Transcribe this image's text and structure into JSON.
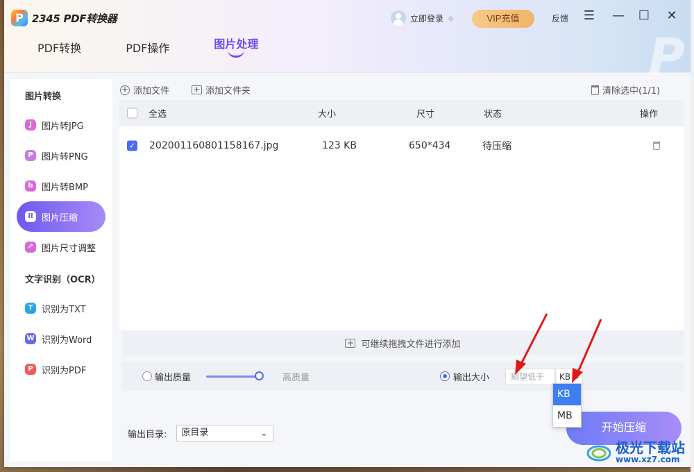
{
  "app": {
    "title": "2345 PDF转换器"
  },
  "header": {
    "login": "立即登录",
    "vip": "VIP充值",
    "feedback": "反馈",
    "tabs": [
      {
        "label": "PDF转换",
        "active": false
      },
      {
        "label": "PDF操作",
        "active": false
      },
      {
        "label": "图片处理",
        "active": true
      }
    ]
  },
  "sidebar": {
    "section_image": "图片转换",
    "section_ocr": "文字识别（OCR）",
    "items": [
      {
        "label": "图片转JPG",
        "icon": "J",
        "color": "#d86ad8",
        "active": false
      },
      {
        "label": "图片转PNG",
        "icon": "P",
        "color": "#c77be0",
        "active": false
      },
      {
        "label": "图片转BMP",
        "icon": "b",
        "color": "#d86ad8",
        "active": false
      },
      {
        "label": "图片压缩",
        "icon": "II",
        "color": "#ffffff",
        "active": true
      },
      {
        "label": "图片尺寸调整",
        "icon": "↗",
        "color": "#d86ad8",
        "active": false
      },
      {
        "label": "识别为TXT",
        "icon": "T",
        "color": "#2aa6e0",
        "active": false
      },
      {
        "label": "识别为Word",
        "icon": "W",
        "color": "#6a6ae6",
        "active": false
      },
      {
        "label": "识别为PDF",
        "icon": "P",
        "color": "#f05a5a",
        "active": false
      }
    ]
  },
  "toolbar": {
    "add_file": "添加文件",
    "add_folder": "添加文件夹",
    "clear_selected": "清除选中(1/1)"
  },
  "table": {
    "headers": {
      "select_all": "全选",
      "size": "大小",
      "dimension": "尺寸",
      "status": "状态",
      "action": "操作"
    },
    "rows": [
      {
        "name": "202001160801158167.jpg",
        "size": "123 KB",
        "dimension": "650*434",
        "status": "待压缩",
        "checked": true
      }
    ]
  },
  "dropzone": {
    "hint": "可继续拖拽文件进行添加"
  },
  "options": {
    "quality_label": "输出质量",
    "quality_level": "高质量",
    "size_label": "输出大小",
    "size_placeholder": "期望低于",
    "unit": "KB",
    "unit_options": [
      "KB",
      "MB"
    ],
    "selected_mode": "size"
  },
  "output": {
    "dir_label": "输出目录:",
    "dir_value": "原目录"
  },
  "actions": {
    "start": "开始压缩"
  },
  "watermark": {
    "name": "极光下载站",
    "url": "www.xz7.com"
  }
}
